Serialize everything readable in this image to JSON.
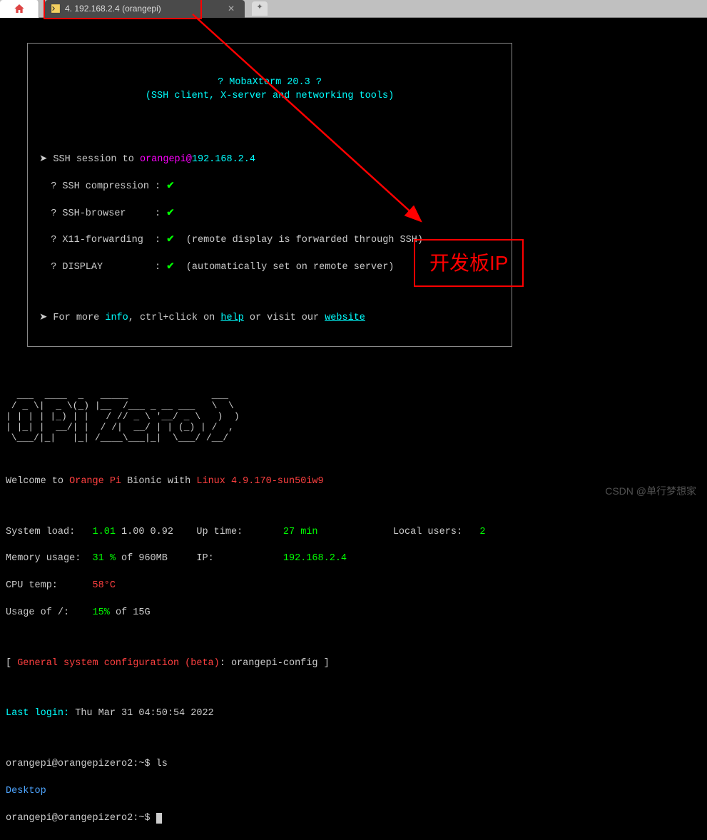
{
  "tab": {
    "title": "4. 192.168.2.4 (orangepi)",
    "close": "✕"
  },
  "new_tab_label": "✦",
  "banner": {
    "title_q": "?",
    "title_name": "MobaXterm 20.3",
    "title_q2": "?",
    "subtitle": "(SSH client, X-server and networking tools)",
    "ssh_session_prefix": "SSH session to ",
    "ssh_user": "orangepi",
    "ssh_at": "@",
    "ssh_host": "192.168.2.4",
    "line_compression": "? SSH compression :",
    "line_browser": "? SSH-browser     :",
    "line_x11": "? X11-forwarding  :",
    "line_display": "? DISPLAY         :",
    "x11_note": "(remote display is forwarded through SSH)",
    "display_note": "(automatically set on remote server)",
    "more_prefix": "For more ",
    "info": "info",
    "more_mid": ", ctrl+click on ",
    "help": "help",
    "more_mid2": " or visit our ",
    "website": "website"
  },
  "ascii": "  ___  ____  _   _____\n / _ \\|  _ \\(_) |__  /___ _ __ ___   \\ \\\n| | | | |_) | |   / // _ \\ '__/ _ \\   \\ \\\n| |_| |  __/| |  / /|  __/ | | (_) |  / /\n \\___/|_|   |_| /____\\___|_|  \\___/  /_/",
  "welcome": {
    "prefix": "Welcome to ",
    "orange": "Orange Pi",
    "mid": " Bionic with ",
    "linux": "Linux 4.9.170-sun50iw9"
  },
  "stats": {
    "load_label": "System load:",
    "load_green": "1.01",
    "load_rest": " 1.00 0.92",
    "uptime_label": "Up time:",
    "uptime_val": "27 min",
    "users_label": "Local users:",
    "users_val": "2",
    "mem_label": "Memory usage:",
    "mem_green": "31 %",
    "mem_rest": " of 960MB",
    "ip_label": "IP:",
    "ip_val": "192.168.2.4",
    "cpu_label": "CPU temp:",
    "cpu_val": "58°C",
    "usage_label": "Usage of /:",
    "usage_green": "15%",
    "usage_rest": " of 15G"
  },
  "config": {
    "open": "[ ",
    "text": "General system configuration (beta)",
    "rest": ": orangepi-config ]"
  },
  "last_login": {
    "label": "Last login:",
    "value": " Thu Mar 31 04:50:54 2022"
  },
  "prompt": {
    "line1": "orangepi@orangepizero2:~$ ls",
    "desktop": "Desktop",
    "line2": "orangepi@orangepizero2:~$ "
  },
  "annotation": {
    "label": "开发板IP"
  },
  "watermark": "CSDN @单行梦想家"
}
